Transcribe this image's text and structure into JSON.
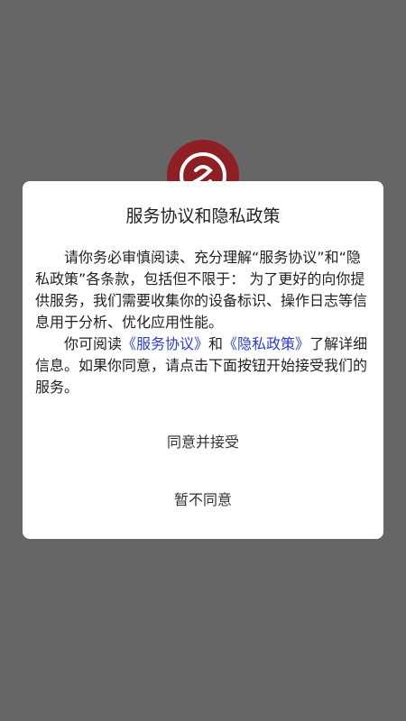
{
  "colors": {
    "backdrop": "#666666",
    "dialog_background": "#ffffff",
    "link": "#2f3fc4",
    "logo": "#8e1f24"
  },
  "app_logo": {
    "icon": "app-logo-icon"
  },
  "dialog": {
    "title": "服务协议和隐私政策",
    "paragraph1": "请你务必审慎阅读、充分理解“服务协议”和“隐私政策”各条款，包括但不限于： 为了更好的向你提供服务，我们需要收集你的设备标识、操作日志等信息用于分析、优化应用性能。",
    "paragraph2_prefix": "你可阅读",
    "service_agreement_link": "《服务协议》",
    "paragraph2_and": "和",
    "privacy_policy_link": "《隐私政策》",
    "paragraph2_suffix": "了解详细信息。如果你同意，请点击下面按钮开始接受我们的服务。",
    "accept_button": "同意并接受",
    "decline_button": "暂不同意"
  }
}
